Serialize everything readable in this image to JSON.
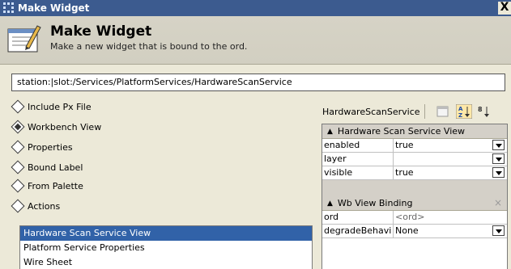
{
  "window": {
    "title": "Make Widget",
    "close_label": "X"
  },
  "header": {
    "title": "Make Widget",
    "subtitle": "Make a new widget that is bound to the ord."
  },
  "ord": {
    "value": "station:|slot:/Services/PlatformServices/HardwareScanService"
  },
  "options": [
    {
      "label": "Include Px File",
      "selected": false
    },
    {
      "label": "Workbench View",
      "selected": true
    },
    {
      "label": "Properties",
      "selected": false
    },
    {
      "label": "Bound Label",
      "selected": false
    },
    {
      "label": "From Palette",
      "selected": false
    },
    {
      "label": "Actions",
      "selected": false
    }
  ],
  "view_list": [
    {
      "label": "Hardware Scan Service View",
      "selected": true
    },
    {
      "label": "Platform Service Properties",
      "selected": false
    },
    {
      "label": "Wire Sheet",
      "selected": false
    }
  ],
  "right_toolbar": {
    "target_name": "HardwareScanService\\",
    "sort_az_icon": "sort-az-icon",
    "sort_options_icon": "sort-options-icon",
    "new_icon": "new-widget-icon"
  },
  "property_sheet": {
    "section1": {
      "title": "Hardware Scan Service View"
    },
    "section1_rows": [
      {
        "name": "enabled",
        "value": "true"
      },
      {
        "name": "layer",
        "value": ""
      },
      {
        "name": "visible",
        "value": "true"
      }
    ],
    "section2": {
      "title": "Wb View Binding",
      "close_label": "×"
    },
    "section2_rows": [
      {
        "name": "ord",
        "value": "<ord>"
      },
      {
        "name": "degradeBehavi",
        "value": "None"
      }
    ]
  }
}
